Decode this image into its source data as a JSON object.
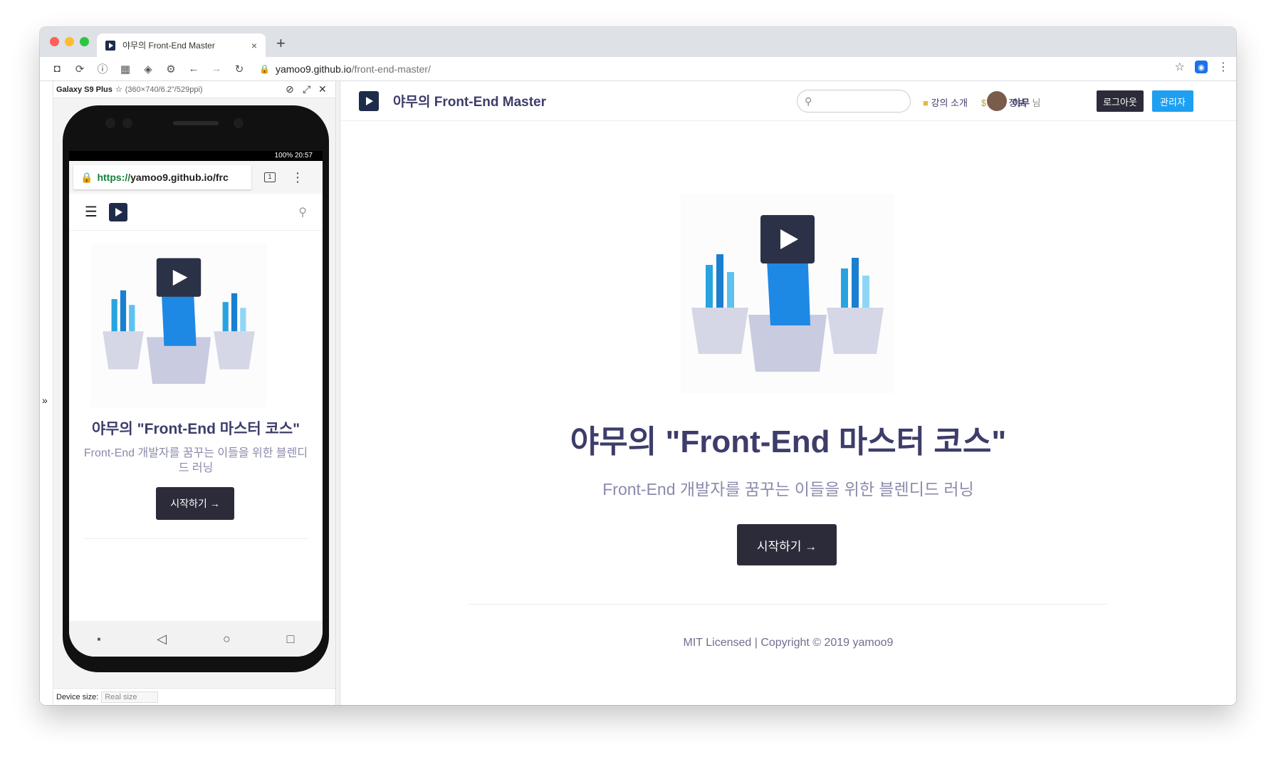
{
  "browser": {
    "tab_title": "야무의 Front-End Master",
    "tab_close": "×",
    "new_tab": "+",
    "url_host": "yamoo9.github.io",
    "url_path": "/front-end-master/"
  },
  "devtools": {
    "device_name": "Galaxy S9 Plus",
    "device_spec": "(360×740/6.2\"/529ppi)",
    "device_size_label": "Device size:",
    "device_size_value": "Real size"
  },
  "mobile": {
    "status": "100%  20:57",
    "url_scheme": "https://",
    "url_text": " yamoo9.github.io/frc",
    "tabs_count": "1",
    "title": "야무의 \"Front-End 마스터 코스\"",
    "subtitle": "Front-End 개발자를 꿈꾸는 이들을 위한 블렌디드 러닝",
    "start_button": "시작하기 →"
  },
  "site": {
    "brand": "야무의 Front-End Master",
    "nav": {
      "course_intro": "강의 소개",
      "payment_info": "결제 정보",
      "user_name": "야무",
      "user_suffix": "님",
      "logout": "로그아웃",
      "admin": "관리자"
    },
    "hero": {
      "title": "야무의 \"Front-End 마스터 코스\"",
      "subtitle": "Front-End 개발자를 꿈꾸는 이들을 위한 블렌디드 러닝",
      "start_button": "시작하기 →"
    },
    "footer": "MIT Licensed | Copyright © 2019 yamoo9"
  },
  "colors": {
    "brand_dark": "#1f2b4a",
    "title_purple": "#3d3d6b",
    "sub_purple": "#8a8aad",
    "admin_blue": "#1e9ff2",
    "button_dark": "#2b2b3a"
  }
}
